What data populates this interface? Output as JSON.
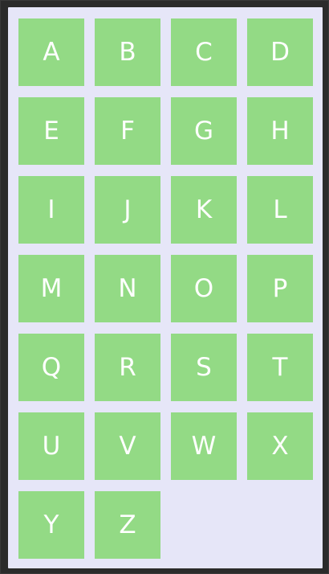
{
  "colors": {
    "frame": "#2b2b2b",
    "panel": "#e6e6f8",
    "tile": "#93da85",
    "tile_text": "#ffffff"
  },
  "tiles": [
    "A",
    "B",
    "C",
    "D",
    "E",
    "F",
    "G",
    "H",
    "I",
    "J",
    "K",
    "L",
    "M",
    "N",
    "O",
    "P",
    "Q",
    "R",
    "S",
    "T",
    "U",
    "V",
    "W",
    "X",
    "Y",
    "Z"
  ]
}
